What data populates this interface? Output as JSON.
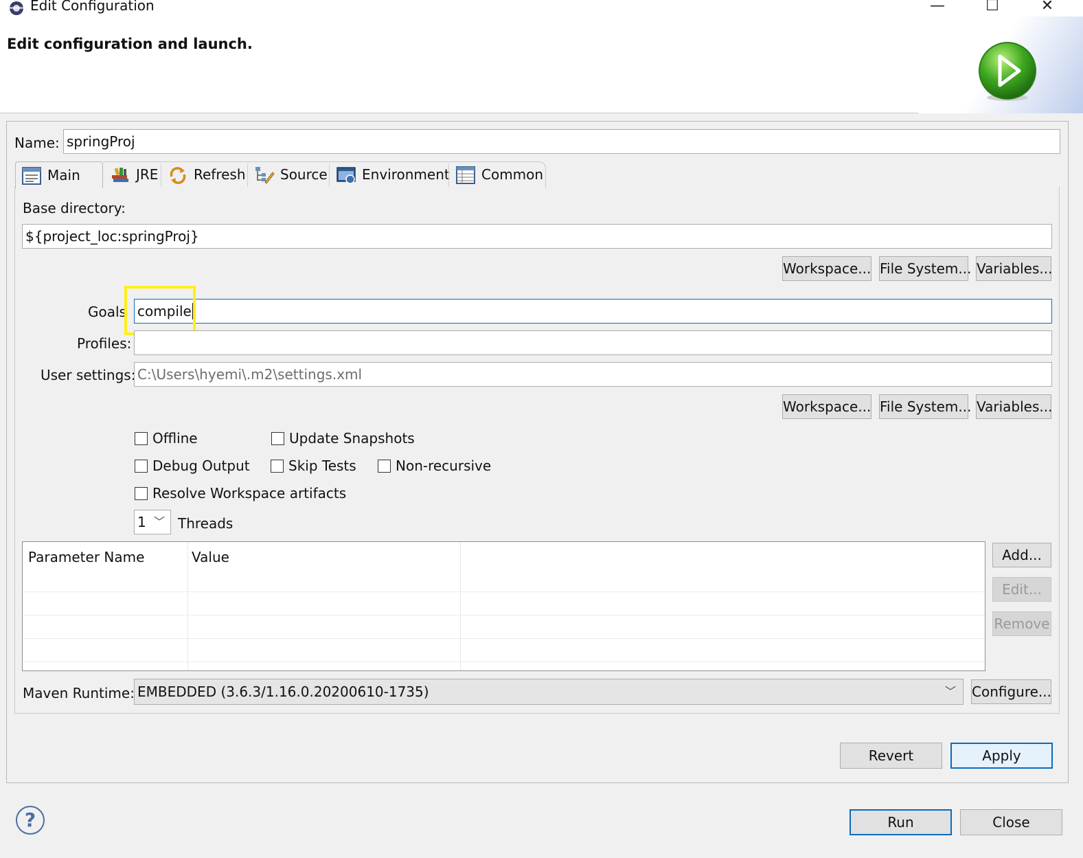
{
  "window": {
    "title": "Edit Configuration",
    "minimize_glyph": "—",
    "maximize_glyph": "☐",
    "close_glyph": "✕"
  },
  "header": {
    "title": "Edit configuration and launch."
  },
  "name_field": {
    "label": "Name:",
    "value": "springProj"
  },
  "tabs": [
    {
      "label": "Main",
      "icon": "main-tab-icon",
      "selected": true
    },
    {
      "label": "JRE",
      "icon": "jre-books-icon",
      "selected": false
    },
    {
      "label": "Refresh",
      "icon": "refresh-icon",
      "selected": false
    },
    {
      "label": "Source",
      "icon": "source-tree-icon",
      "selected": false
    },
    {
      "label": "Environment",
      "icon": "environment-icon",
      "selected": false
    },
    {
      "label": "Common",
      "icon": "common-table-icon",
      "selected": false
    }
  ],
  "base_directory": {
    "label": "Base directory:",
    "value": "${project_loc:springProj}",
    "buttons": {
      "workspace": "Workspace...",
      "file_system": "File System...",
      "variables": "Variables..."
    }
  },
  "goals": {
    "label": "Goals",
    "value": "compile"
  },
  "profiles": {
    "label": "Profiles:",
    "value": ""
  },
  "user_settings": {
    "label": "User settings:",
    "value": "C:\\Users\\hyemi\\.m2\\settings.xml",
    "buttons": {
      "workspace": "Workspace...",
      "file_system": "File System...",
      "variables": "Variables..."
    }
  },
  "options": {
    "offline": {
      "label": "Offline",
      "checked": false
    },
    "update_snapshots": {
      "label": "Update Snapshots",
      "checked": false
    },
    "debug_output": {
      "label": "Debug Output",
      "checked": false
    },
    "skip_tests": {
      "label": "Skip Tests",
      "checked": false
    },
    "non_recursive": {
      "label": "Non-recursive",
      "checked": false
    },
    "resolve_workspace": {
      "label": "Resolve Workspace artifacts",
      "checked": false
    }
  },
  "threads": {
    "value": "1",
    "label": "Threads"
  },
  "parameters": {
    "columns": [
      "Parameter Name",
      "Value"
    ],
    "rows": [],
    "buttons": {
      "add": "Add...",
      "edit": "Edit...",
      "remove": "Remove"
    }
  },
  "maven_runtime": {
    "label": "Maven Runtime:",
    "value": "EMBEDDED (3.6.3/1.16.0.20200610-1735)",
    "configure": "Configure..."
  },
  "actions": {
    "revert": "Revert",
    "apply": "Apply"
  },
  "footer": {
    "run": "Run",
    "close": "Close",
    "help_glyph": "?"
  },
  "colors": {
    "highlight": "#ffef1a",
    "focus_border": "#0a6cbd"
  }
}
